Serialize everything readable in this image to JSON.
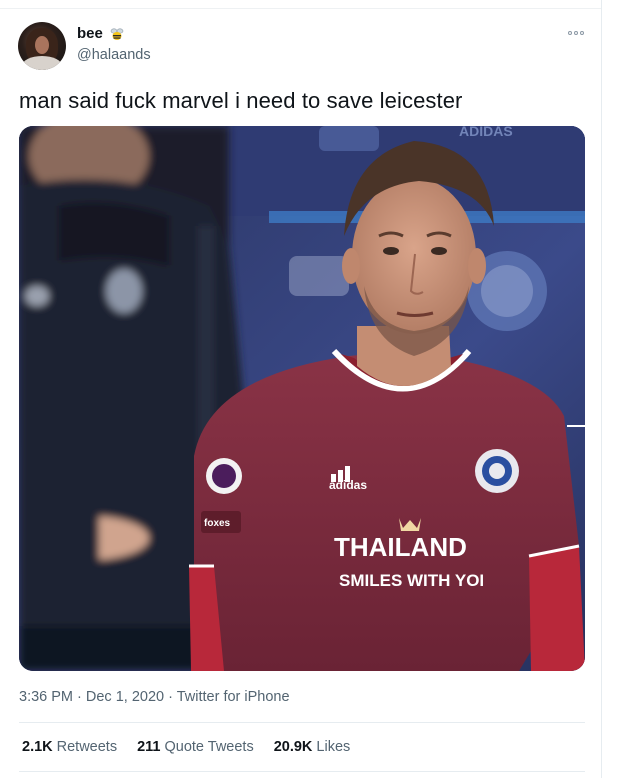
{
  "author": {
    "display_name": "bee",
    "handle": "@halaands",
    "name_badge_icon": "bee-icon"
  },
  "tweet": {
    "text": "man said fuck marvel i need to save leicester",
    "media": {
      "kind": "photo",
      "jersey_sponsor_line1": "THAILAND",
      "jersey_sponsor_line2": "SMILES WITH YOI",
      "jersey_brand": "adidas",
      "sleeve_patch": "foxes"
    },
    "time": "3:36 PM",
    "date": "Dec 1, 2020",
    "source": "Twitter for iPhone",
    "separator": " · "
  },
  "stats": {
    "retweets_count": "2.1K",
    "retweets_label": "Retweets",
    "quotes_count": "211",
    "quotes_label": "Quote Tweets",
    "likes_count": "20.9K",
    "likes_label": "Likes"
  },
  "colors": {
    "text_primary": "#0f1419",
    "text_secondary": "#536471",
    "jersey": "#7a2a3d",
    "sleeve": "#b8283a",
    "background_stadium": "#1b2140"
  }
}
